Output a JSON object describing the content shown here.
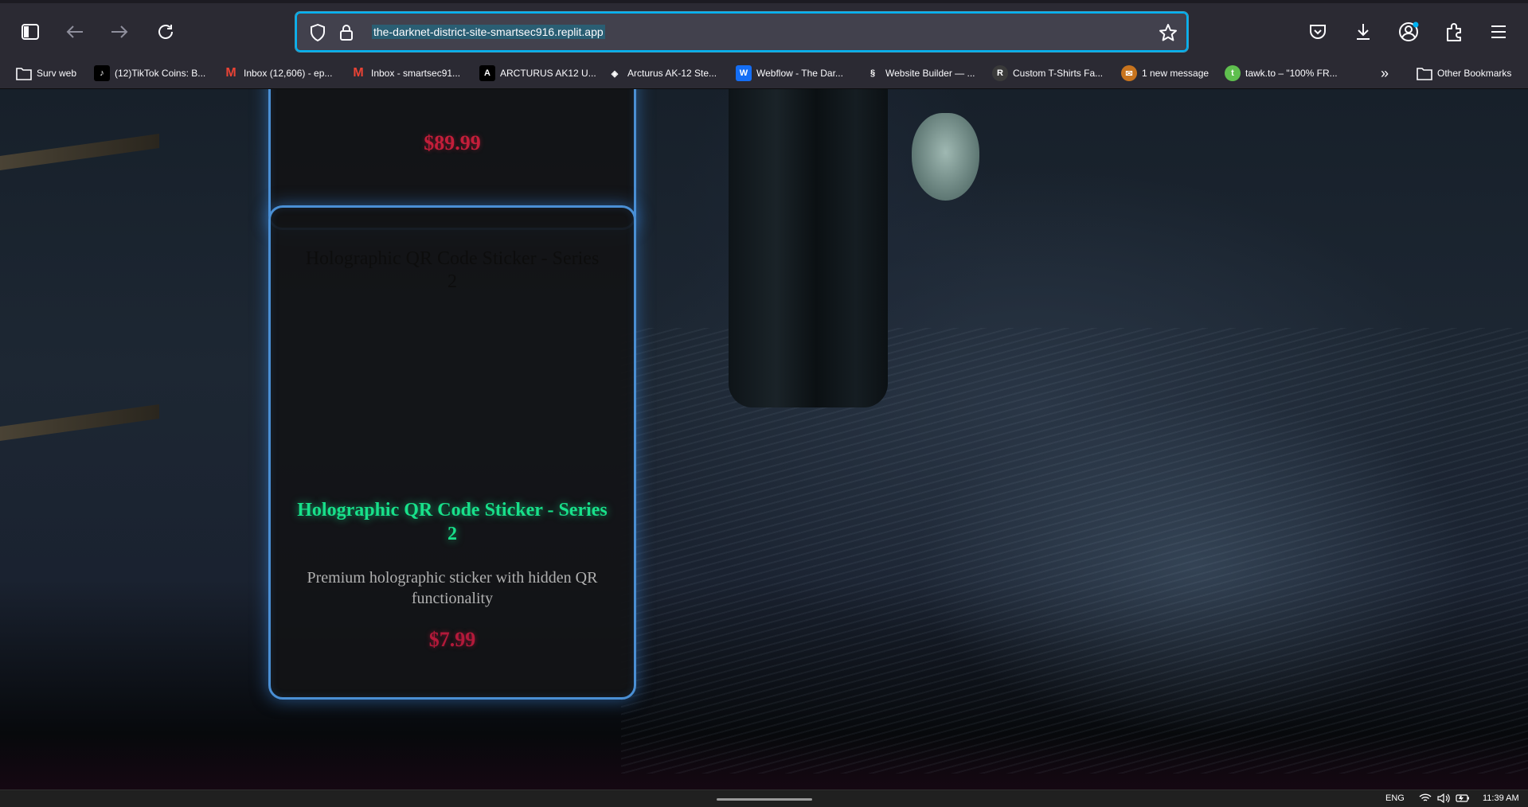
{
  "browser": {
    "url": "the-darknet-district-site-smartsec916.replit.app",
    "toolbar_icons": [
      "sidebar-icon",
      "back-arrow-icon",
      "forward-arrow-icon",
      "reload-icon",
      "shield-icon",
      "lock-icon",
      "star-icon",
      "pocket-icon",
      "download-icon",
      "account-icon",
      "extensions-icon",
      "menu-icon"
    ]
  },
  "bookmarks": {
    "items": [
      {
        "label": "Surv web",
        "icon": "folder-icon"
      },
      {
        "label": "(12)TikTok Coins: B...",
        "icon": "tiktok-icon"
      },
      {
        "label": "Inbox (12,606) - ep...",
        "icon": "gmail-icon"
      },
      {
        "label": "Inbox - smartsec91...",
        "icon": "gmail-icon"
      },
      {
        "label": "ARCTURUS AK12 U...",
        "icon": "arcturus-icon"
      },
      {
        "label": "Arcturus AK-12 Ste...",
        "icon": "arcturus-logo-icon"
      },
      {
        "label": "Webflow - The Dar...",
        "icon": "webflow-icon"
      },
      {
        "label": "Website Builder — ...",
        "icon": "squarespace-icon"
      },
      {
        "label": "Custom T-Shirts Fa...",
        "icon": "r-logo-icon"
      },
      {
        "label": "1 new message",
        "icon": "message-icon"
      },
      {
        "label": "tawk.to – \"100% FR...",
        "icon": "tawk-icon"
      }
    ],
    "overflow_icon": "chevrons-right-icon",
    "other": "Other Bookmarks"
  },
  "products": {
    "previous": {
      "price": "$89.99"
    },
    "current": {
      "image_alt": "Holographic QR Code Sticker - Series 2",
      "title": "Holographic QR Code Sticker - Series 2",
      "description": "Premium holographic sticker with hidden QR functionality",
      "price": "$7.99"
    }
  },
  "taskbar": {
    "language": "ENG",
    "time": "11:39 AM",
    "tray_icons": [
      "wifi-icon",
      "volume-icon",
      "battery-icon"
    ]
  },
  "colors": {
    "accent": "#00b3f4",
    "card_border": "#4a8fd4",
    "title_green": "#18e08a",
    "price_red": "#b3193a"
  }
}
